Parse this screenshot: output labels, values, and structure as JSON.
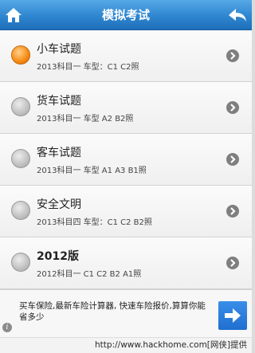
{
  "header": {
    "title": "模拟考试"
  },
  "items": [
    {
      "name": "小车试题",
      "sub": "2013科目一 车型：C1 C2照",
      "selected": true,
      "bold": false
    },
    {
      "name": "货车试题",
      "sub": "2013科目一 车型 A2 B2照",
      "selected": false,
      "bold": false
    },
    {
      "name": "客车试题",
      "sub": "2013科目一 车型 A1 A3 B1照",
      "selected": false,
      "bold": false
    },
    {
      "name": "安全文明",
      "sub": "2013科目四 车型：C1 C2 B2照",
      "selected": false,
      "bold": false
    },
    {
      "name": "2012版",
      "sub": "2012科目一 C1 C2 B2 A1照",
      "selected": false,
      "bold": true
    }
  ],
  "ad": {
    "text": "买车保险,最新车险计算器, 快速车险报价,算算你能省多少"
  },
  "footer": {
    "url": "http://www.hackhome.com[网侠]提供"
  },
  "colors": {
    "header": "#2f86d0",
    "selected_radio": "#f68a12",
    "ad_button": "#1f6fd0"
  }
}
